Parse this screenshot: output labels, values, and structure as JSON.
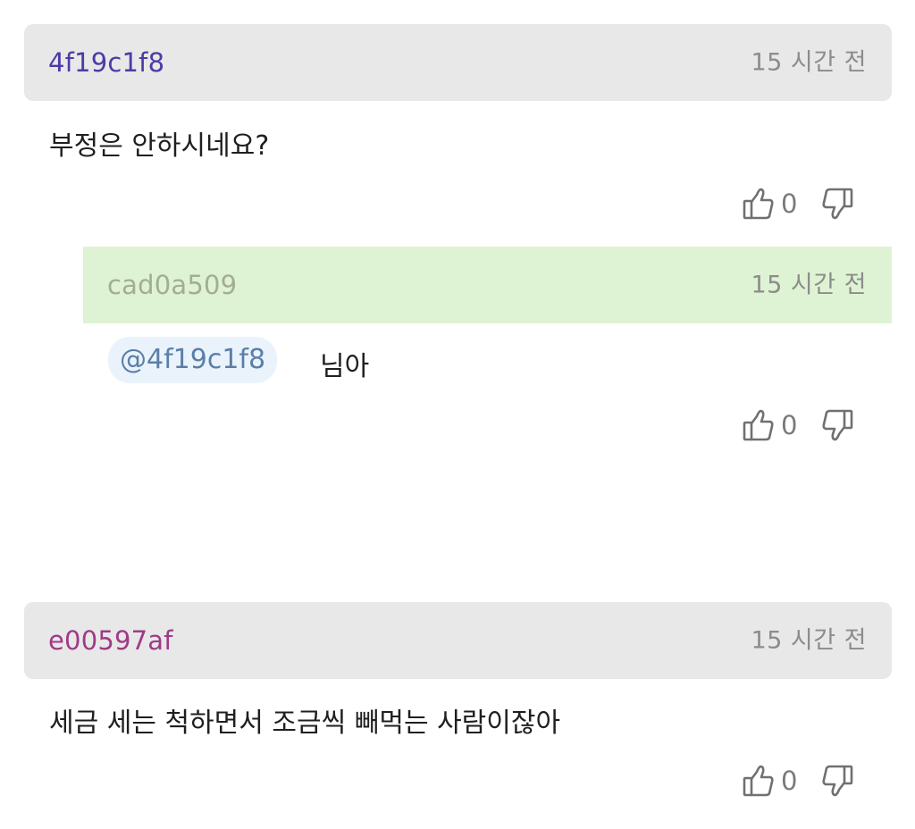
{
  "comments": [
    {
      "author": "4f19c1f8",
      "author_color": "#4d3aa6",
      "time": "15 시간 전",
      "text": "부정은 안하시네요?",
      "likes": "0"
    },
    {
      "author": "e00597af",
      "author_color": "#a03a86",
      "time": "15 시간 전",
      "text": "세금 세는 척하면서 조금씩 빼먹는 사람이잖아",
      "likes": "0"
    }
  ],
  "reply": {
    "author": "cad0a509",
    "author_color": "#a3ad94",
    "time": "15 시간 전",
    "mention": "@4f19c1f8",
    "text": "님아",
    "likes": "0"
  },
  "icons": {
    "like": "thumbs-up-icon",
    "dislike": "thumbs-down-icon"
  },
  "colors": {
    "header_gray": "#e8e8e8",
    "header_green": "#def3d3",
    "mention_bg": "#eaf3fb",
    "mention_text": "#5b7fa8",
    "time_text": "#8c8c8c",
    "count_text": "#7a7a7a"
  }
}
